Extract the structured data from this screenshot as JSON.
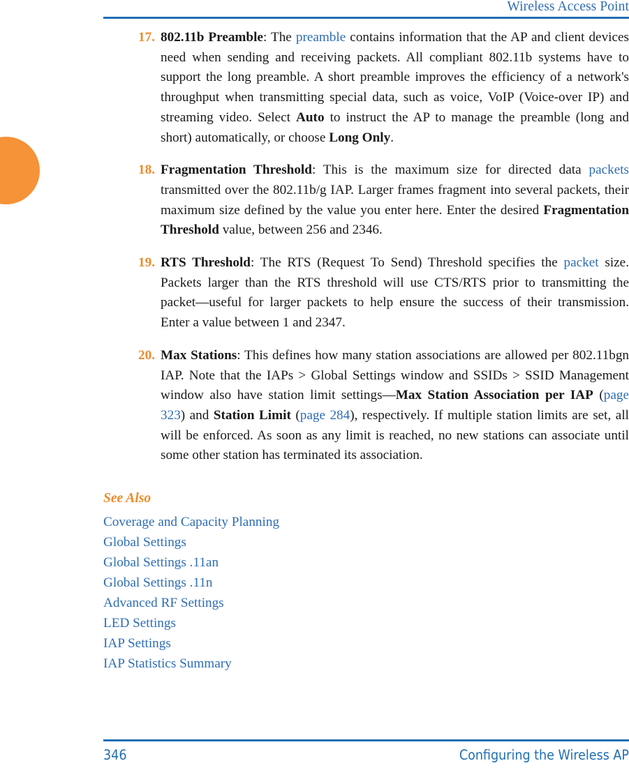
{
  "header": {
    "title": "Wireless Access Point"
  },
  "footer": {
    "page_number": "346",
    "section": "Configuring the Wireless AP"
  },
  "colors": {
    "accent_orange": "#f69237",
    "link_blue": "#2e6db4",
    "rule_blue": "#1f6fb2",
    "body_text": "#1a1a1a"
  },
  "list": {
    "items": [
      {
        "number": "17.",
        "segments": [
          {
            "type": "bold",
            "text": "802.11b Preamble"
          },
          {
            "type": "plain",
            "text": ": The "
          },
          {
            "type": "link",
            "text": "preamble"
          },
          {
            "type": "plain",
            "text": " contains information that the AP and client devices need when sending and receiving packets. All compliant 802.11b systems have to support the long preamble. A short preamble improves the efficiency of a network's throughput when transmitting special data, such as voice, VoIP (Voice-over IP) and streaming video. Select "
          },
          {
            "type": "bold",
            "text": "Auto"
          },
          {
            "type": "plain",
            "text": " to instruct the AP to manage the preamble (long and short) automatically, or choose "
          },
          {
            "type": "bold",
            "text": "Long Only"
          },
          {
            "type": "plain",
            "text": "."
          }
        ]
      },
      {
        "number": "18.",
        "segments": [
          {
            "type": "bold",
            "text": "Fragmentation Threshold"
          },
          {
            "type": "plain",
            "text": ": This is the maximum size for directed data "
          },
          {
            "type": "link",
            "text": "packets"
          },
          {
            "type": "plain",
            "text": " transmitted over the 802.11b/g IAP. Larger frames fragment into several packets, their maximum size defined by the value you enter here. Enter the desired "
          },
          {
            "type": "bold",
            "text": "Fragmentation Threshold"
          },
          {
            "type": "plain",
            "text": " value, between 256 and 2346."
          }
        ]
      },
      {
        "number": "19.",
        "segments": [
          {
            "type": "bold",
            "text": "RTS Threshold"
          },
          {
            "type": "plain",
            "text": ": The RTS (Request To Send) Threshold specifies the "
          },
          {
            "type": "link",
            "text": "packet"
          },
          {
            "type": "plain",
            "text": " size. Packets larger than the RTS threshold will use CTS/RTS prior to transmitting the packet—useful for larger packets to help ensure the success of their transmission. Enter a value between 1 and 2347."
          }
        ]
      },
      {
        "number": "20.",
        "segments": [
          {
            "type": "bold",
            "text": "Max Stations"
          },
          {
            "type": "plain",
            "text": ": This defines how many station associations are allowed per 802.11bgn IAP. Note that the IAPs > Global Settings window and SSIDs > SSID Management window also have station limit settings—"
          },
          {
            "type": "bold",
            "text": "Max Station Association per IAP"
          },
          {
            "type": "plain",
            "text": " ("
          },
          {
            "type": "link",
            "text": "page 323"
          },
          {
            "type": "plain",
            "text": ") and "
          },
          {
            "type": "bold",
            "text": "Station Limit"
          },
          {
            "type": "plain",
            "text": " ("
          },
          {
            "type": "link",
            "text": "page 284"
          },
          {
            "type": "plain",
            "text": "), respectively. If multiple station limits are set, all will be enforced. As soon as any limit is reached, no new stations can associate until some other station has terminated its association."
          }
        ]
      }
    ]
  },
  "see_also": {
    "title": "See Also",
    "links": [
      "Coverage and Capacity Planning",
      "Global Settings",
      "Global Settings .11an",
      "Global Settings .11n",
      "Advanced RF Settings",
      "LED Settings",
      "IAP Settings",
      "IAP Statistics Summary"
    ]
  }
}
